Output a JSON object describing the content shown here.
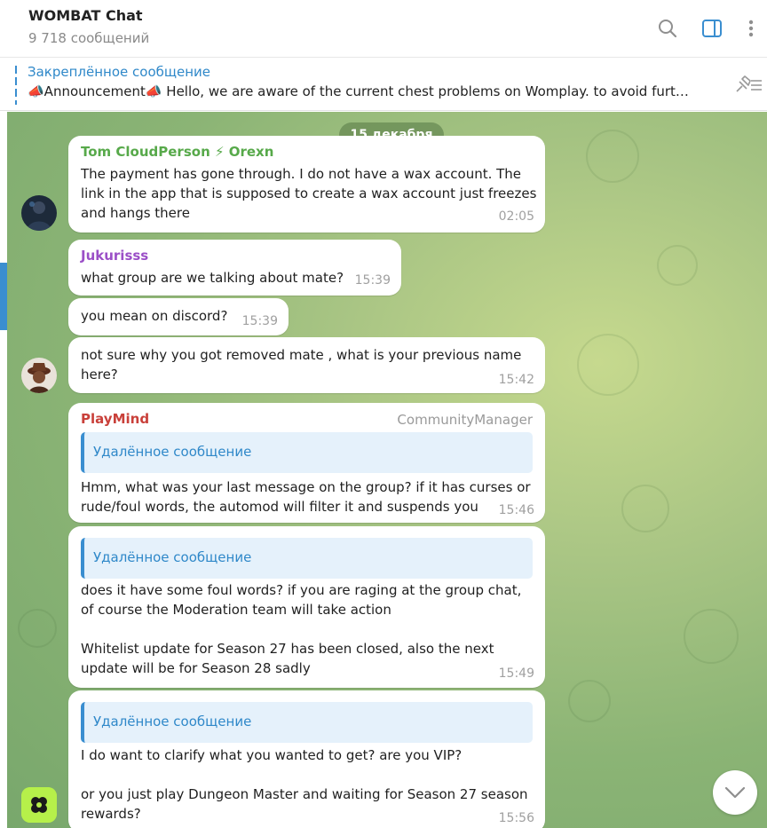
{
  "header": {
    "title": "WOMBAT Chat",
    "subtitle": "9 718 сообщений",
    "icons": [
      "search-icon",
      "sidebar-toggle-icon",
      "more-vertical-icon"
    ],
    "accent_color": "#3a8ed0"
  },
  "pinned": {
    "title": "Закреплённое сообщение",
    "text": "📣Announcement📣  Hello, we are aware of the current chest problems on Womplay. to avoid furt…"
  },
  "date_separator": "15 декабря",
  "messages": [
    {
      "sender": "Tom CloudPerson ⚡ Orexn",
      "sender_color": "#57a94a",
      "text": "The payment has gone through. I do not have a wax account. The\nlink in the app that is supposed to create a wax account just freezes\nand hangs there",
      "time": "02:05"
    },
    {
      "sender": "Jukurisss",
      "sender_color": "#9b4fc7",
      "text": "what group are we talking about mate?",
      "time": "15:39"
    },
    {
      "text": "you mean on discord?",
      "time": "15:39"
    },
    {
      "text": "not sure why you got removed mate , what is your previous name\nhere?",
      "time": "15:42"
    },
    {
      "sender": "PlayMind",
      "sender_color": "#c9403a",
      "role": "CommunityManager",
      "reply": "Удалённое сообщение",
      "text": "Hmm, what was your last message on the group? if it has curses or\nrude/foul words, the automod will filter it and suspends you",
      "time": "15:46"
    },
    {
      "reply": "Удалённое сообщение",
      "text": "does it have some foul words? if you are raging at the group chat,\nof course the Moderation team will take action\n\nWhitelist update for Season 27 has been closed, also the next\nupdate will be for Season 28 sadly",
      "time": "15:49"
    },
    {
      "reply": "Удалённое сообщение",
      "text": "I do want to clarify what you wanted to get? are you VIP?\n\nor you just play Dungeon Master and waiting for Season 27 season\nrewards?",
      "time": "15:56"
    }
  ]
}
